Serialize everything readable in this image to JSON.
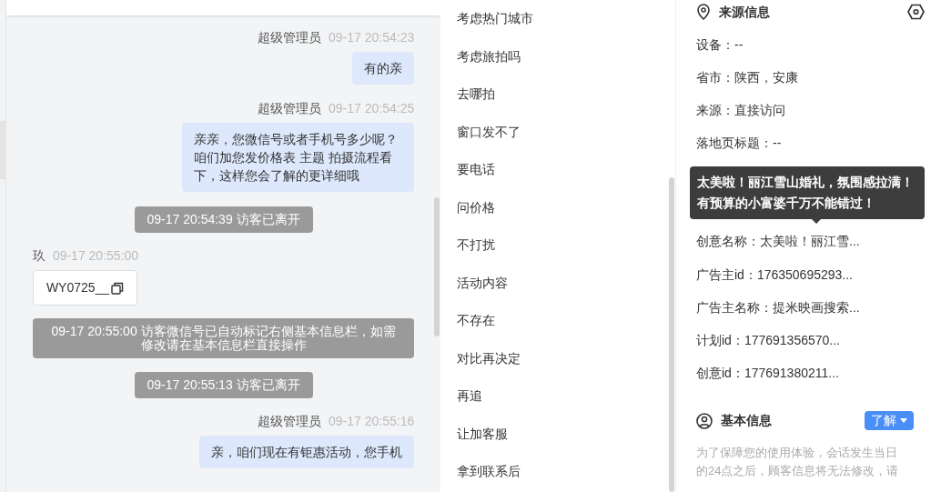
{
  "chat": {
    "messages": [
      {
        "kind": "agent",
        "sender": "超级管理员",
        "time": "09-17 20:54:23",
        "text": "有的亲"
      },
      {
        "kind": "agent",
        "sender": "超级管理员",
        "time": "09-17 20:54:25",
        "text": "亲亲，您微信号或者手机号多少呢？咱们加您发价格表 主题 拍摄流程看下，这样您会了解的更详细哦"
      },
      {
        "kind": "system",
        "text": "09-17 20:54:39 访客已离开"
      },
      {
        "kind": "visitor",
        "sender": "玖",
        "time": "09-17 20:55:00",
        "text": "WY0725__"
      },
      {
        "kind": "system",
        "text": "09-17 20:55:00 访客微信号已自动标记右侧基本信息栏，如需修改请在基本信息栏直接操作"
      },
      {
        "kind": "system",
        "text": "09-17 20:55:13 访客已离开"
      },
      {
        "kind": "agent",
        "sender": "超级管理员",
        "time": "09-17 20:55:16",
        "text": "亲，咱们现在有钜惠活动，您手机"
      }
    ]
  },
  "quick_replies": [
    "考虑热门城市",
    "考虑旅拍吗",
    "去哪拍",
    "窗口发不了",
    "要电话",
    "问价格",
    "不打扰",
    "活动内容",
    "不存在",
    "对比再决定",
    "再追",
    "让加客服",
    "拿到联系后"
  ],
  "source_info": {
    "title": "来源信息",
    "rows_above_tooltip": [
      "设备：--",
      "省市：陕西，安康",
      "来源：直接访问",
      "落地页标题：--"
    ],
    "rows_below_tooltip": [
      "创意名称：太美啦！丽江雪...",
      "广告主id：176350695293...",
      "广告主名称：提米映画搜索...",
      "计划id：177691356570...",
      "创意id：177691380211..."
    ],
    "tooltip": "太美啦！丽江雪山婚礼，氛围感拉满！有预算的小富婆千万不能错过！"
  },
  "basic_info": {
    "title": "基本信息",
    "button": "了解",
    "note": "为了保障您的使用体验，会话发生当日的24点之后，顾客信息将无法修改，请"
  }
}
